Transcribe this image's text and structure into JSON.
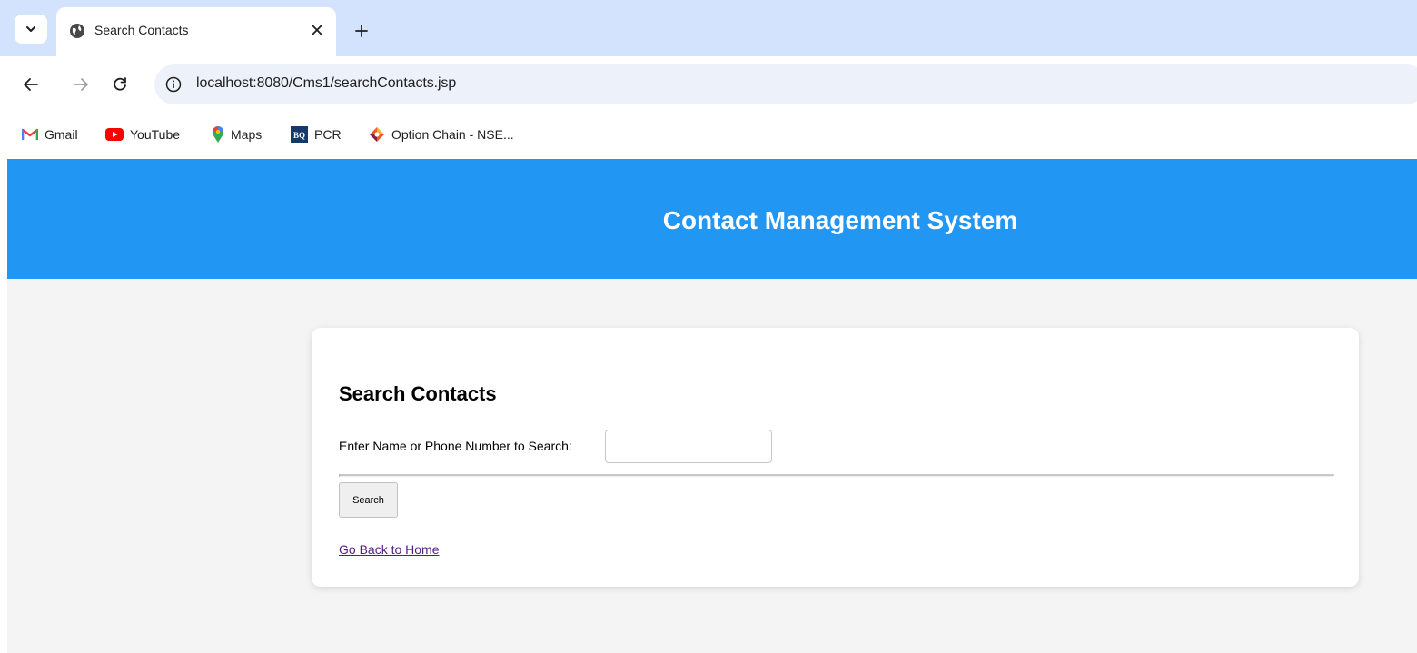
{
  "browser": {
    "tab": {
      "title": "Search Contacts"
    },
    "url": "localhost:8080/Cms1/searchContacts.jsp",
    "bookmarks": [
      {
        "label": "Gmail",
        "icon": "gmail-icon"
      },
      {
        "label": "YouTube",
        "icon": "youtube-icon"
      },
      {
        "label": "Maps",
        "icon": "maps-icon"
      },
      {
        "label": "PCR",
        "icon": "pcr-icon"
      },
      {
        "label": "Option Chain - NSE...",
        "icon": "nse-icon"
      }
    ]
  },
  "header": {
    "title": "Contact Management System"
  },
  "search": {
    "heading": "Search Contacts",
    "label": "Enter Name or Phone Number to Search:",
    "input_value": "",
    "button_label": "Search",
    "back_link": "Go Back to Home"
  },
  "colors": {
    "header_bg": "#2196f3",
    "page_bg": "#f4f4f4",
    "card_bg": "#ffffff",
    "link": "#551a8b"
  }
}
